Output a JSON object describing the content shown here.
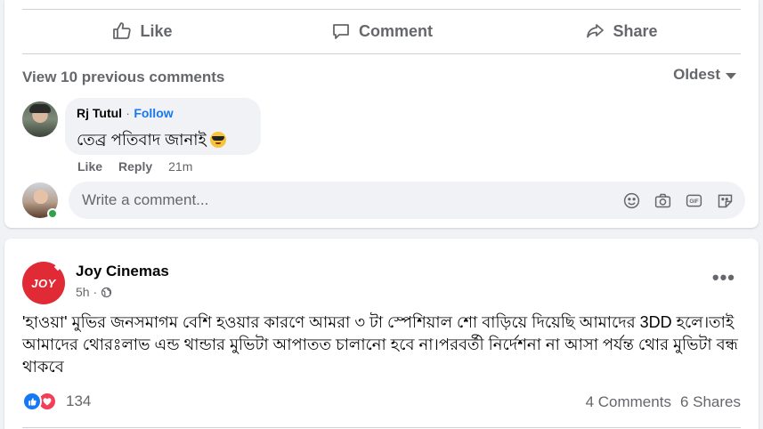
{
  "actions": {
    "like": "Like",
    "comment": "Comment",
    "share": "Share"
  },
  "comments_header": {
    "view_previous": "View 10 previous comments",
    "sort": "Oldest"
  },
  "comment": {
    "author": "Rj Tutul",
    "separator": "·",
    "follow": "Follow",
    "text": "তেব্র পতিবাদ জানাই",
    "like": "Like",
    "reply": "Reply",
    "time": "21m"
  },
  "composer": {
    "placeholder": "Write a comment..."
  },
  "post": {
    "page_name": "Joy Cinemas",
    "logo_text": "JOY",
    "time": "5h ·",
    "text": "'হাওয়া' মুভির জনসমাগম বেশি হওয়ার কারণে আমরা ৩ টা স্পেশিয়াল শো বাড়িয়ে দিয়েছি আমাদের 3DD হলে।তাই আমাদের থোরঃলাভ এন্ড থান্ডার মুভিটা আপাতত চালানো হবে না।পরবর্তী নির্দেশনা না আসা পর্যন্ত  থোর মুভিটা বন্ধ থাকবে",
    "reaction_count": "134",
    "comments": "4 Comments",
    "shares": "6 Shares"
  },
  "colors": {
    "accent": "#1877f2",
    "love": "#f33e58",
    "online": "#31a24c",
    "brand": "#e02a36"
  }
}
